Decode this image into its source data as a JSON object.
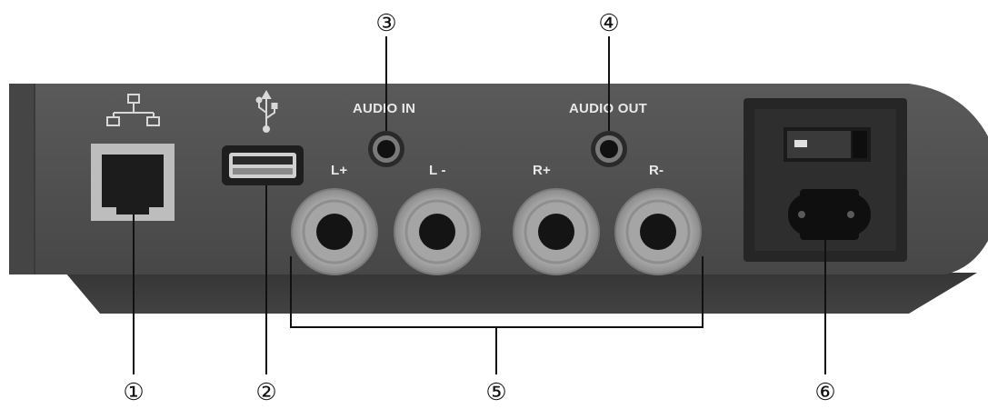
{
  "colors": {
    "body_main": "#4f4f4f",
    "body_top": "#595959",
    "body_bottom": "#3a3a3a",
    "body_dark": "#2a2a2a",
    "port_light": "#bdbdbd",
    "label_text": "#e8e8e8",
    "callout_line": "#111111"
  },
  "ports": {
    "ethernet": {
      "icon": "network-icon"
    },
    "usb": {
      "icon": "usb-icon"
    },
    "audio_in": {
      "label": "AUDIO IN"
    },
    "audio_out": {
      "label": "AUDIO OUT"
    },
    "speaker_terminals": [
      {
        "label": "L+"
      },
      {
        "label": "L -"
      },
      {
        "label": "R+"
      },
      {
        "label": "R-"
      }
    ],
    "power": {
      "icon": "power-switch-icon"
    }
  },
  "callouts": [
    "①",
    "②",
    "③",
    "④",
    "⑤",
    "⑥"
  ]
}
